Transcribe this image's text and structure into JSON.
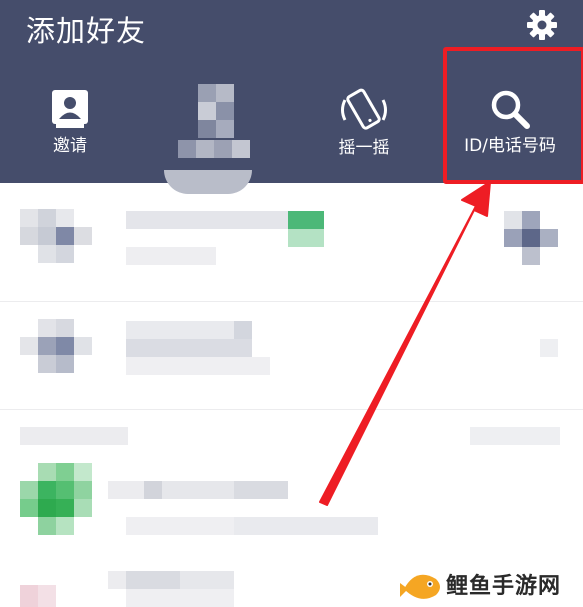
{
  "header": {
    "title": "添加好友",
    "nav": [
      {
        "label": "邀请",
        "icon": "contacts-icon"
      },
      {
        "label": "",
        "icon": "qr-code-icon"
      },
      {
        "label": "摇一摇",
        "icon": "shake-phone-icon"
      },
      {
        "label": "ID/电话号码",
        "icon": "search-icon"
      }
    ],
    "settings_icon": "gear-icon"
  },
  "annotation": {
    "highlight_color": "#ee1d24",
    "target": "ID/电话号码"
  },
  "watermark": {
    "text": "鲤鱼手游网",
    "logo": "fish-logo-icon"
  },
  "colors": {
    "header_bg": "#454d6b",
    "accent_green": "#3cb460"
  }
}
